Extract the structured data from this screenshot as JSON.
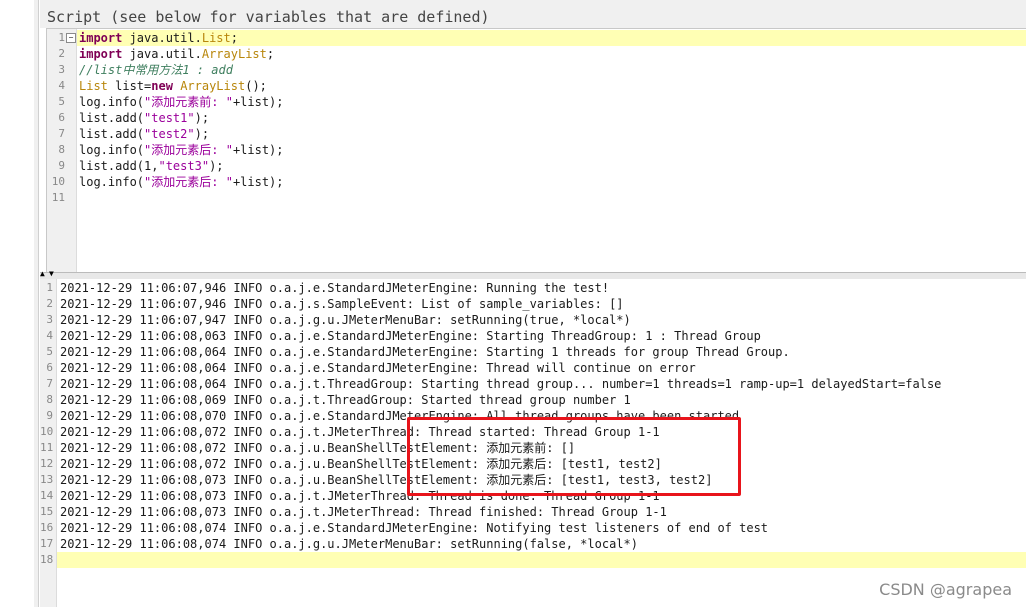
{
  "script_panel": {
    "title": "Script (see below for variables that are defined)",
    "lines": [
      {
        "num": "1",
        "parts": [
          [
            "kw",
            "import"
          ],
          [
            "plain",
            " java.util."
          ],
          [
            "type",
            "List"
          ],
          [
            "plain",
            ";"
          ]
        ]
      },
      {
        "num": "2",
        "parts": [
          [
            "kw",
            "import"
          ],
          [
            "plain",
            " java.util."
          ],
          [
            "type",
            "ArrayList"
          ],
          [
            "plain",
            ";"
          ]
        ]
      },
      {
        "num": "3",
        "parts": [
          [
            "cmt",
            "//list中常用方法1 : add"
          ]
        ]
      },
      {
        "num": "4",
        "parts": [
          [
            "type",
            "List"
          ],
          [
            "plain",
            " list="
          ],
          [
            "kw",
            "new"
          ],
          [
            "plain",
            " "
          ],
          [
            "type",
            "ArrayList"
          ],
          [
            "plain",
            "();"
          ]
        ]
      },
      {
        "num": "5",
        "parts": [
          [
            "plain",
            "log.info("
          ],
          [
            "str",
            "\"添加元素前: \""
          ],
          [
            "plain",
            "+list);"
          ]
        ]
      },
      {
        "num": "6",
        "parts": [
          [
            "plain",
            "list.add("
          ],
          [
            "str",
            "\"test1\""
          ],
          [
            "plain",
            ");"
          ]
        ]
      },
      {
        "num": "7",
        "parts": [
          [
            "plain",
            "list.add("
          ],
          [
            "str",
            "\"test2\""
          ],
          [
            "plain",
            ");"
          ]
        ]
      },
      {
        "num": "8",
        "parts": [
          [
            "plain",
            "log.info("
          ],
          [
            "str",
            "\"添加元素后: \""
          ],
          [
            "plain",
            "+list);"
          ]
        ]
      },
      {
        "num": "9",
        "parts": [
          [
            "plain",
            "list.add(1,"
          ],
          [
            "str",
            "\"test3\""
          ],
          [
            "plain",
            ");"
          ]
        ]
      },
      {
        "num": "10",
        "parts": [
          [
            "plain",
            "log.info("
          ],
          [
            "str",
            "\"添加元素后: \""
          ],
          [
            "plain",
            "+list);"
          ]
        ]
      },
      {
        "num": "11",
        "parts": []
      }
    ]
  },
  "log_panel": {
    "lines": [
      {
        "num": "1",
        "text": "2021-12-29 11:06:07,946 INFO o.a.j.e.StandardJMeterEngine: Running the test!"
      },
      {
        "num": "2",
        "text": "2021-12-29 11:06:07,946 INFO o.a.j.s.SampleEvent: List of sample_variables: []"
      },
      {
        "num": "3",
        "text": "2021-12-29 11:06:07,947 INFO o.a.j.g.u.JMeterMenuBar: setRunning(true, *local*)"
      },
      {
        "num": "4",
        "text": "2021-12-29 11:06:08,063 INFO o.a.j.e.StandardJMeterEngine: Starting ThreadGroup: 1 : Thread Group"
      },
      {
        "num": "5",
        "text": "2021-12-29 11:06:08,064 INFO o.a.j.e.StandardJMeterEngine: Starting 1 threads for group Thread Group."
      },
      {
        "num": "6",
        "text": "2021-12-29 11:06:08,064 INFO o.a.j.e.StandardJMeterEngine: Thread will continue on error"
      },
      {
        "num": "7",
        "text": "2021-12-29 11:06:08,064 INFO o.a.j.t.ThreadGroup: Starting thread group... number=1 threads=1 ramp-up=1 delayedStart=false"
      },
      {
        "num": "8",
        "text": "2021-12-29 11:06:08,069 INFO o.a.j.t.ThreadGroup: Started thread group number 1"
      },
      {
        "num": "9",
        "text": "2021-12-29 11:06:08,070 INFO o.a.j.e.StandardJMeterEngine: All thread groups have been started"
      },
      {
        "num": "10",
        "text": "2021-12-29 11:06:08,072 INFO o.a.j.t.JMeterThread: Thread started: Thread Group 1-1"
      },
      {
        "num": "11",
        "text": "2021-12-29 11:06:08,072 INFO o.a.j.u.BeanShellTestElement: 添加元素前: []"
      },
      {
        "num": "12",
        "text": "2021-12-29 11:06:08,072 INFO o.a.j.u.BeanShellTestElement: 添加元素后: [test1, test2]"
      },
      {
        "num": "13",
        "text": "2021-12-29 11:06:08,073 INFO o.a.j.u.BeanShellTestElement: 添加元素后: [test1, test3, test2]"
      },
      {
        "num": "14",
        "text": "2021-12-29 11:06:08,073 INFO o.a.j.t.JMeterThread: Thread is done: Thread Group 1-1"
      },
      {
        "num": "15",
        "text": "2021-12-29 11:06:08,073 INFO o.a.j.t.JMeterThread: Thread finished: Thread Group 1-1"
      },
      {
        "num": "16",
        "text": "2021-12-29 11:06:08,074 INFO o.a.j.e.StandardJMeterEngine: Notifying test listeners of end of test"
      },
      {
        "num": "17",
        "text": "2021-12-29 11:06:08,074 INFO o.a.j.g.u.JMeterMenuBar: setRunning(false, *local*)"
      },
      {
        "num": "18",
        "text": ""
      }
    ]
  },
  "watermark": "CSDN @agrapea",
  "colors": {
    "highlight": "#ffffb4",
    "annotation_box": "#e8141b"
  }
}
